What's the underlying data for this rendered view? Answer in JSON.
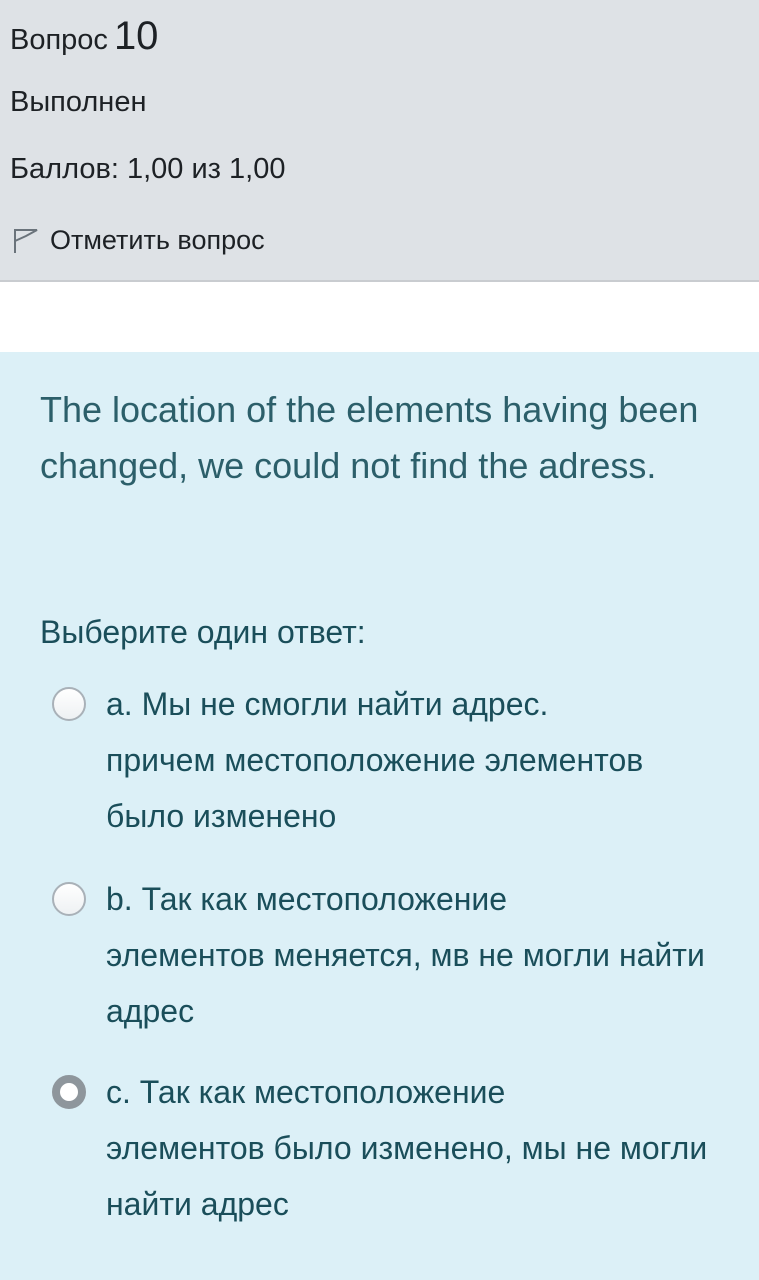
{
  "info": {
    "question_word": "Вопрос",
    "question_number": "10",
    "state": "Выполнен",
    "grade": "Баллов: 1,00 из 1,00",
    "flag_label": "Отметить вопрос",
    "flag_icon": "flag-icon"
  },
  "question": {
    "text": "The location of the elements having been changed, we could not find the adress.",
    "prompt": "Выберите один ответ:",
    "options": [
      {
        "letter": "a.",
        "text_line1": "Мы не смогли найти адрес.",
        "text_rest": "причем местоположение элементов было изменено",
        "checked": false
      },
      {
        "letter": "b.",
        "text_line1": "Так как местоположение",
        "text_rest": "элементов меняется, мв не могли найти адрес",
        "checked": false
      },
      {
        "letter": "c.",
        "text_line1": "Так как местоположение",
        "text_rest": "элементов было изменено, мы не могли найти адрес",
        "checked": true
      }
    ]
  }
}
